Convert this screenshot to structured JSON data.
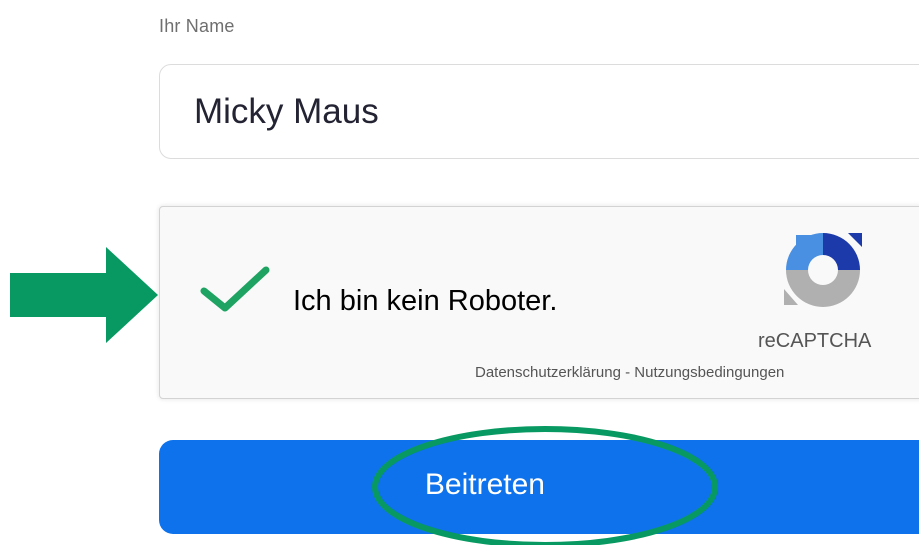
{
  "form": {
    "name_label": "Ihr Name",
    "name_value": "Micky Maus",
    "submit_label": "Beitreten"
  },
  "recaptcha": {
    "checkbox_label": "Ich bin kein Roboter.",
    "checked": true,
    "brand": "reCAPTCHA",
    "privacy_link": "Datenschutzerklärung",
    "separator": " - ",
    "terms_link": "Nutzungsbedingungen"
  },
  "icons": {
    "checkmark": "check-icon",
    "recaptcha_logo": "recaptcha-logo-icon",
    "annotation_arrow": "arrow-right-icon",
    "annotation_ellipse": "ellipse-highlight"
  },
  "colors": {
    "primary_button": "#0e72ed",
    "checkmark": "#1ea362",
    "annotation": "#079961",
    "recaptcha_blue": "#1c3aa9",
    "recaptcha_lightblue": "#4a90e2",
    "recaptcha_gray": "#b0b0b0"
  }
}
